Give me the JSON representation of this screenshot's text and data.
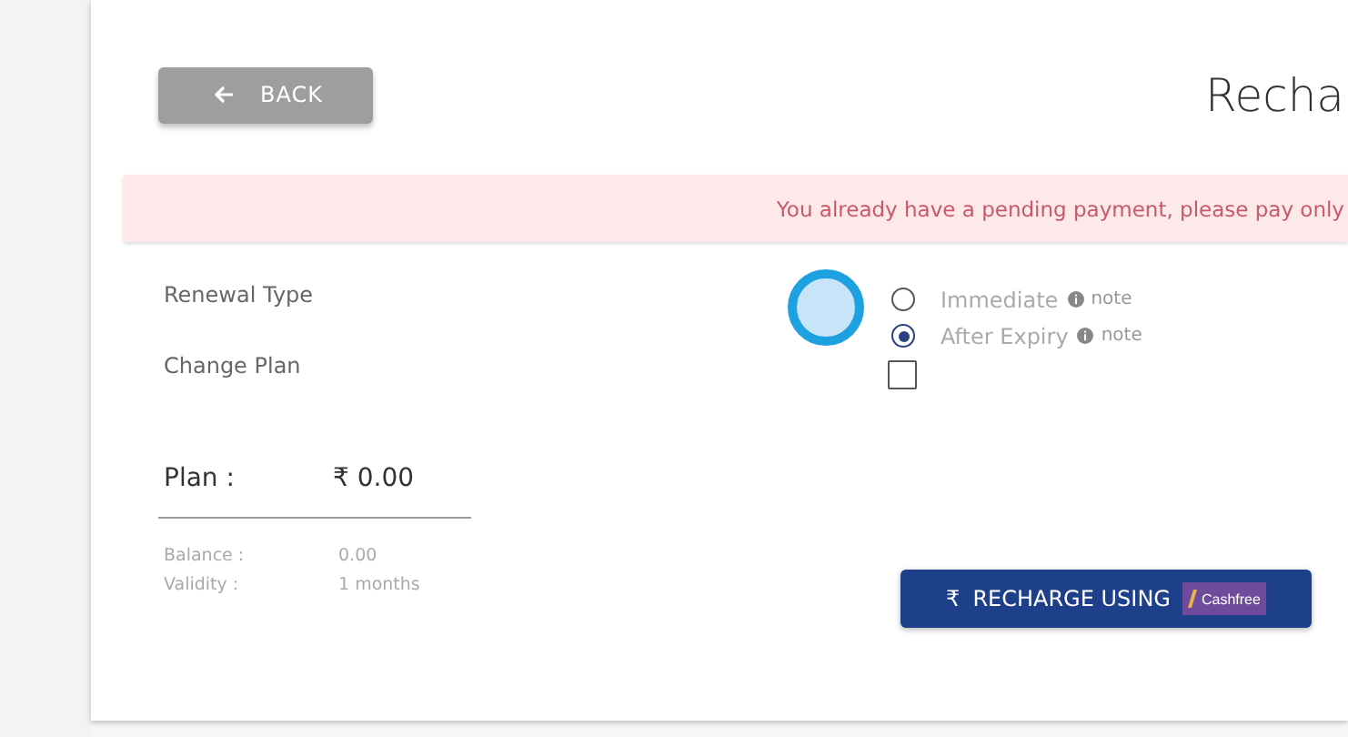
{
  "back_button": {
    "label": "BACK"
  },
  "title": "Recha",
  "alert": {
    "text": "You already have a pending payment, please pay only"
  },
  "renewal_type": {
    "label": "Renewal Type",
    "options": [
      {
        "label": "Immediate",
        "note": "note",
        "selected": false
      },
      {
        "label": "After Expiry",
        "note": "note",
        "selected": true
      }
    ]
  },
  "change_plan": {
    "label": "Change Plan",
    "checked": false
  },
  "plan": {
    "label": "Plan :",
    "price": "₹ 0.00",
    "details": [
      {
        "label": "Balance :",
        "value": "0.00"
      },
      {
        "label": "Validity :",
        "value": "1 months"
      }
    ]
  },
  "recharge_button": {
    "rupee": "₹",
    "label": "RECHARGE USING",
    "brand": "Cashfree"
  }
}
